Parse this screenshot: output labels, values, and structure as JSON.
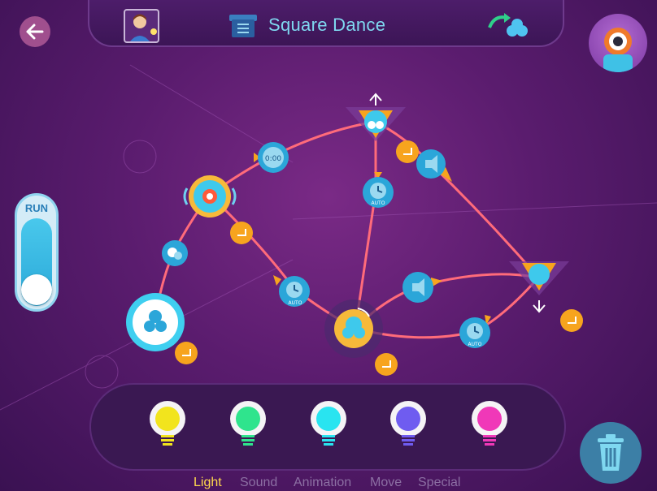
{
  "header": {
    "title": "Square Dance",
    "back_icon": "arrow-left-icon",
    "profile_icon": "person-lightbulb-icon",
    "menu_icon": "list-menu-icon",
    "robot_icon": "robot-switch-icon"
  },
  "run": {
    "label": "RUN"
  },
  "program": {
    "blocks": [
      {
        "kind": "start",
        "icon": "dash-robot-icon"
      },
      {
        "kind": "move",
        "icon": "robot-move-icon"
      },
      {
        "kind": "eye",
        "icon": "eye-light-icon"
      },
      {
        "kind": "display",
        "icon": "display-counter-icon"
      },
      {
        "kind": "move-up",
        "icon": "robot-move-up-icon"
      },
      {
        "kind": "wait",
        "icon": "timer-icon",
        "label": "AUTO"
      },
      {
        "kind": "sound",
        "icon": "speaker-sound-icon"
      },
      {
        "kind": "wait",
        "icon": "timer-icon",
        "label": "AUTO"
      },
      {
        "kind": "center",
        "icon": "robot-turn-icon"
      },
      {
        "kind": "sound",
        "icon": "speaker-sound-icon"
      },
      {
        "kind": "move-down",
        "icon": "robot-move-down-icon"
      },
      {
        "kind": "wait",
        "icon": "timer-icon",
        "label": "AUTO"
      }
    ]
  },
  "palette": {
    "items": [
      {
        "name": "yellow-light",
        "color": "#f2e41d"
      },
      {
        "name": "green-light",
        "color": "#2fe48d"
      },
      {
        "name": "cyan-light",
        "color": "#29e4f0"
      },
      {
        "name": "purple-light",
        "color": "#6f5cf0"
      },
      {
        "name": "pink-light",
        "color": "#f038b8"
      }
    ]
  },
  "tabs": [
    {
      "label": "Light",
      "active": true
    },
    {
      "label": "Sound",
      "active": false
    },
    {
      "label": "Animation",
      "active": false
    },
    {
      "label": "Move",
      "active": false
    },
    {
      "label": "Special",
      "active": false
    }
  ],
  "colors": {
    "accent": "#7fd8f0",
    "wire": "#ff6b7a",
    "node_orange": "#f7a41e",
    "node_blue": "#2ba6d9",
    "active_tab": "#ffd84d"
  },
  "trash": {
    "icon": "trash-icon"
  }
}
